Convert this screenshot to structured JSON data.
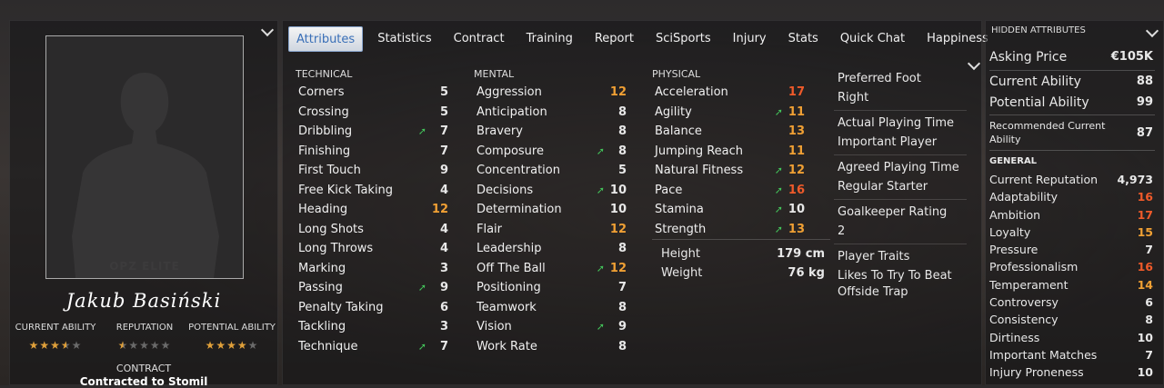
{
  "player": {
    "name": "Jakub Basiński",
    "photo_brand": "OPZ ELITE",
    "current_ability_label": "CURRENT ABILITY",
    "reputation_label": "REPUTATION",
    "potential_ability_label": "POTENTIAL ABILITY",
    "current_ability_stars": 3.5,
    "reputation_stars": 0.5,
    "potential_ability_stars": 4,
    "contract_label": "CONTRACT",
    "contract_value": "Contracted to Stomil"
  },
  "tabs": [
    "Attributes",
    "Statistics",
    "Contract",
    "Training",
    "Report",
    "SciSports",
    "Injury",
    "Stats",
    "Quick Chat",
    "Happiness"
  ],
  "active_tab": "Attributes",
  "technical": {
    "heading": "TECHNICAL",
    "items": [
      {
        "name": "Corners",
        "value": "5",
        "color": "normal",
        "arrow": false
      },
      {
        "name": "Crossing",
        "value": "5",
        "color": "normal",
        "arrow": false
      },
      {
        "name": "Dribbling",
        "value": "7",
        "color": "normal",
        "arrow": true
      },
      {
        "name": "Finishing",
        "value": "7",
        "color": "normal",
        "arrow": false
      },
      {
        "name": "First Touch",
        "value": "9",
        "color": "normal",
        "arrow": false
      },
      {
        "name": "Free Kick Taking",
        "value": "4",
        "color": "normal",
        "arrow": false
      },
      {
        "name": "Heading",
        "value": "12",
        "color": "hi",
        "arrow": false
      },
      {
        "name": "Long Shots",
        "value": "4",
        "color": "normal",
        "arrow": false
      },
      {
        "name": "Long Throws",
        "value": "4",
        "color": "normal",
        "arrow": false
      },
      {
        "name": "Marking",
        "value": "3",
        "color": "normal",
        "arrow": false
      },
      {
        "name": "Passing",
        "value": "9",
        "color": "normal",
        "arrow": true
      },
      {
        "name": "Penalty Taking",
        "value": "6",
        "color": "normal",
        "arrow": false
      },
      {
        "name": "Tackling",
        "value": "3",
        "color": "normal",
        "arrow": false
      },
      {
        "name": "Technique",
        "value": "7",
        "color": "normal",
        "arrow": true
      }
    ]
  },
  "mental": {
    "heading": "MENTAL",
    "items": [
      {
        "name": "Aggression",
        "value": "12",
        "color": "hi",
        "arrow": false
      },
      {
        "name": "Anticipation",
        "value": "8",
        "color": "normal",
        "arrow": false
      },
      {
        "name": "Bravery",
        "value": "8",
        "color": "normal",
        "arrow": false
      },
      {
        "name": "Composure",
        "value": "8",
        "color": "normal",
        "arrow": true
      },
      {
        "name": "Concentration",
        "value": "5",
        "color": "normal",
        "arrow": false
      },
      {
        "name": "Decisions",
        "value": "10",
        "color": "normal",
        "arrow": true
      },
      {
        "name": "Determination",
        "value": "10",
        "color": "normal",
        "arrow": false
      },
      {
        "name": "Flair",
        "value": "12",
        "color": "hi",
        "arrow": false
      },
      {
        "name": "Leadership",
        "value": "8",
        "color": "normal",
        "arrow": false
      },
      {
        "name": "Off The Ball",
        "value": "12",
        "color": "hi",
        "arrow": true
      },
      {
        "name": "Positioning",
        "value": "7",
        "color": "normal",
        "arrow": false
      },
      {
        "name": "Teamwork",
        "value": "8",
        "color": "normal",
        "arrow": false
      },
      {
        "name": "Vision",
        "value": "9",
        "color": "normal",
        "arrow": true
      },
      {
        "name": "Work Rate",
        "value": "8",
        "color": "normal",
        "arrow": false
      }
    ]
  },
  "physical": {
    "heading": "PHYSICAL",
    "items": [
      {
        "name": "Acceleration",
        "value": "17",
        "color": "red",
        "arrow": false
      },
      {
        "name": "Agility",
        "value": "11",
        "color": "hi",
        "arrow": true
      },
      {
        "name": "Balance",
        "value": "13",
        "color": "hi",
        "arrow": false
      },
      {
        "name": "Jumping Reach",
        "value": "11",
        "color": "hi",
        "arrow": false
      },
      {
        "name": "Natural Fitness",
        "value": "12",
        "color": "hi",
        "arrow": true
      },
      {
        "name": "Pace",
        "value": "16",
        "color": "red",
        "arrow": true
      },
      {
        "name": "Stamina",
        "value": "10",
        "color": "normal",
        "arrow": true
      },
      {
        "name": "Strength",
        "value": "13",
        "color": "hi",
        "arrow": true
      }
    ],
    "height_label": "Height",
    "height_value": "179 cm",
    "weight_label": "Weight",
    "weight_value": "76 kg"
  },
  "info": {
    "preferred_foot_label": "Preferred Foot",
    "preferred_foot": "Right",
    "playing_time_label": "Actual Playing Time",
    "playing_time": "Important Player",
    "agreed_time_label": "Agreed Playing Time",
    "agreed_time": "Regular Starter",
    "gk_rating_label": "Goalkeeper Rating",
    "gk_rating": "2",
    "traits_label": "Player Traits",
    "traits": "Likes To Try To Beat Offside Trap"
  },
  "hidden": {
    "heading": "HIDDEN ATTRIBUTES",
    "asking_price_label": "Asking Price",
    "asking_price": "€105K",
    "current_ability_label": "Current Ability",
    "current_ability": "88",
    "potential_ability_label": "Potential Ability",
    "potential_ability": "99",
    "rec_ability_label": "Recommended Current Ability",
    "rec_ability": "87",
    "general_heading": "GENERAL",
    "general": [
      {
        "name": "Current Reputation",
        "value": "4,973",
        "color": "normal"
      },
      {
        "name": "Adaptability",
        "value": "16",
        "color": "red"
      },
      {
        "name": "Ambition",
        "value": "17",
        "color": "red"
      },
      {
        "name": "Loyalty",
        "value": "15",
        "color": "hi"
      },
      {
        "name": "Pressure",
        "value": "7",
        "color": "normal"
      },
      {
        "name": "Professionalism",
        "value": "16",
        "color": "red"
      },
      {
        "name": "Temperament",
        "value": "14",
        "color": "hi"
      },
      {
        "name": "Controversy",
        "value": "6",
        "color": "normal"
      },
      {
        "name": "Consistency",
        "value": "8",
        "color": "normal"
      },
      {
        "name": "Dirtiness",
        "value": "10",
        "color": "normal"
      },
      {
        "name": "Important Matches",
        "value": "7",
        "color": "normal"
      },
      {
        "name": "Injury Proneness",
        "value": "10",
        "color": "normal"
      }
    ]
  },
  "colors": {
    "accent": "#3a6fb7",
    "high": "#f0a034",
    "very_high": "#ef5a2a",
    "improve_arrow": "#43c25a"
  }
}
